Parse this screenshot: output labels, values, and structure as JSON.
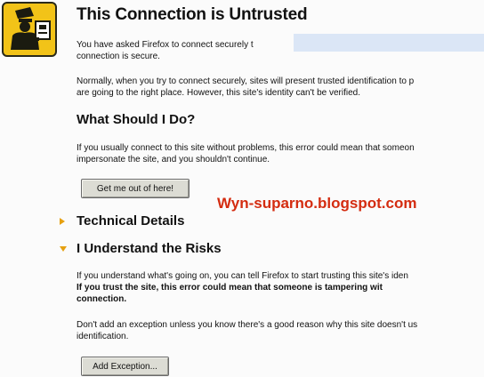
{
  "page": {
    "title": "This Connection is Untrusted",
    "intro_line1": "You have asked Firefox to connect securely t",
    "intro_line2": "connection is secure.",
    "normal_line1": "Normally, when you try to connect securely, sites will present trusted identification to p",
    "normal_line2": "are going to the right place. However, this site's identity can't be verified."
  },
  "what_to_do": {
    "heading": "What Should I Do?",
    "line1": "If you usually connect to this site without problems, this error could mean that someon",
    "line2": "impersonate the site, and you shouldn't continue.",
    "get_me_out_label": "Get me out of here!"
  },
  "watermark": "Wyn-suparno.blogspot.com",
  "technical_details": {
    "label": "Technical Details"
  },
  "understand_risks": {
    "label": "I Understand the Risks",
    "line1": "If you understand what's going on, you can tell Firefox to start trusting this site's iden",
    "line2_bold": "If you trust the site, this error could mean that someone is tampering wit",
    "line3_bold": "connection.",
    "line4": "Don't add an exception unless you know there's a good reason why this site doesn't us",
    "line5": "identification.",
    "add_exception_label": "Add Exception..."
  },
  "colors": {
    "badge": "#f2c318",
    "watermark": "#d42c10",
    "triangle": "#e6a010",
    "redaction": "#dbe6f6"
  },
  "icons": {
    "badge": "security-officer-icon",
    "technical_details": "expand-triangle-right-icon",
    "understand_risks": "expand-triangle-down-icon"
  }
}
